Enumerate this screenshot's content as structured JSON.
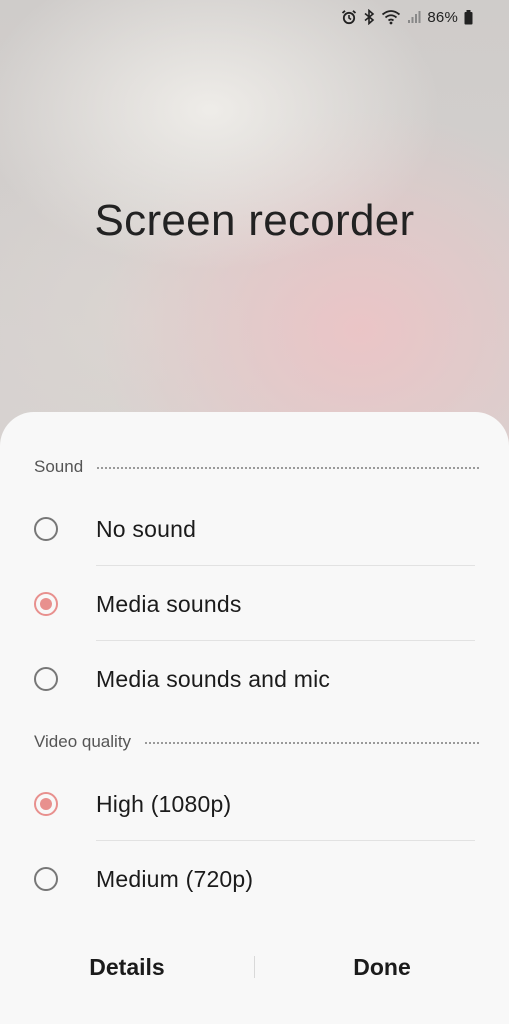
{
  "status_bar": {
    "battery_percent": "86%",
    "icons": [
      "alarm-icon",
      "bluetooth-icon",
      "wifi-icon",
      "signal-icon",
      "battery-icon"
    ]
  },
  "app": {
    "title": "Screen recorder"
  },
  "sound": {
    "header": "Sound",
    "options": [
      {
        "label": "No sound",
        "selected": false
      },
      {
        "label": "Media sounds",
        "selected": true
      },
      {
        "label": "Media sounds and mic",
        "selected": false
      }
    ]
  },
  "video_quality": {
    "header": "Video quality",
    "options": [
      {
        "label": "High (1080p)",
        "selected": true
      },
      {
        "label": "Medium (720p)",
        "selected": false
      }
    ]
  },
  "footer": {
    "details_label": "Details",
    "done_label": "Done"
  },
  "colors": {
    "accent": "#e8908e",
    "sheet_background": "#f8f8f8"
  }
}
